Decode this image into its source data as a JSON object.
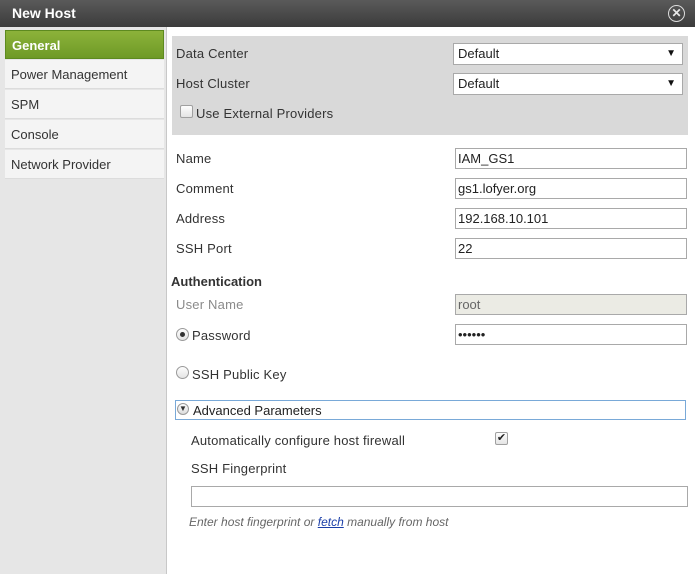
{
  "window": {
    "title": "New Host",
    "close_icon": "close-icon"
  },
  "sidebar": {
    "items": [
      {
        "label": "General",
        "active": true
      },
      {
        "label": "Power Management",
        "active": false
      },
      {
        "label": "SPM",
        "active": false
      },
      {
        "label": "Console",
        "active": false
      },
      {
        "label": "Network Provider",
        "active": false
      }
    ],
    "accent": "#7aa52e"
  },
  "cluster_box": {
    "data_center_label": "Data Center",
    "data_center_value": "Default",
    "host_cluster_label": "Host Cluster",
    "host_cluster_value": "Default",
    "external_providers_label": "Use External Providers",
    "external_providers_checked": false
  },
  "host": {
    "name_label": "Name",
    "name_value": "IAM_GS1",
    "comment_label": "Comment",
    "comment_value": "gs1.lofyer.org",
    "address_label": "Address",
    "address_value": "192.168.10.101",
    "ssh_port_label": "SSH Port",
    "ssh_port_value": "22"
  },
  "auth": {
    "title": "Authentication",
    "user_name_label": "User Name",
    "user_name_value": "root",
    "password_label": "Password",
    "password_value": "••••••",
    "password_selected": true,
    "ssh_key_label": "SSH Public Key",
    "ssh_key_selected": false
  },
  "advanced": {
    "toggle_label": "Advanced Parameters",
    "expanded": true,
    "firewall_label": "Automatically configure host firewall",
    "firewall_checked": true,
    "fingerprint_label": "SSH Fingerprint",
    "fingerprint_value": "",
    "hint_prefix": "Enter host fingerprint or ",
    "hint_link": "fetch",
    "hint_suffix": " manually from host"
  }
}
